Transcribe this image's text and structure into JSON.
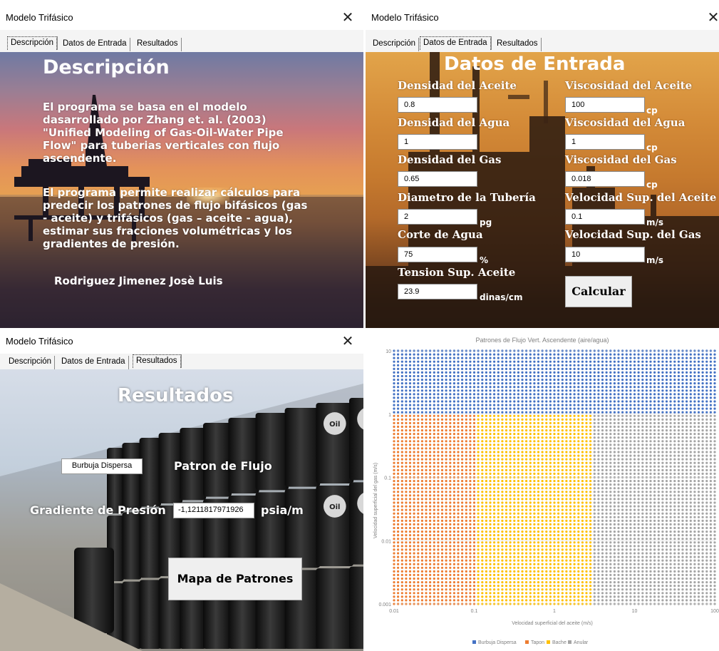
{
  "window1": {
    "title": "Modelo Trifásico",
    "close": "✕",
    "tabs": [
      "Descripción",
      "Datos de Entrada",
      "Resultados"
    ],
    "heading": "Descripción",
    "paragraph1": "El programa se basa en el modelo dasarrollado por Zhang et. al. (2003) \"Unified Modeling of Gas-Oil-Water Pipe Flow\" para tuberias verticales con flujo ascendente.",
    "paragraph2": "El programa permite realizar cálculos para predecir los patrones de flujo bifásicos (gas - aceite) y trifásicos (gas – aceite - agua), estimar sus fracciones volumétricas y los gradientes de presión.",
    "author": "Rodriguez Jimenez Josè Luis"
  },
  "window2": {
    "title": "Modelo Trifásico",
    "close": "✕",
    "tabs": [
      "Descripción",
      "Datos de Entrada",
      "Resultados"
    ],
    "heading": "Datos de Entrada",
    "fields": {
      "densidad_aceite": {
        "label": "Densidad del Aceite",
        "value": "0.8",
        "unit": ""
      },
      "densidad_agua": {
        "label": "Densidad del Agua",
        "value": "1",
        "unit": ""
      },
      "densidad_gas": {
        "label": "Densidad del Gas",
        "value": "0.65",
        "unit": ""
      },
      "diametro": {
        "label": "Diametro de la Tubería",
        "value": "2",
        "unit": "pg"
      },
      "corte_agua": {
        "label": "Corte de Agua",
        "value": "75",
        "unit": "%"
      },
      "tension": {
        "label": "Tension Sup. Aceite",
        "value": "23.9",
        "unit": "dinas/cm"
      },
      "visc_aceite": {
        "label": "Viscosidad del Aceite",
        "value": "100",
        "unit": "cp"
      },
      "visc_agua": {
        "label": "Viscosidad del Agua",
        "value": "1",
        "unit": "cp"
      },
      "visc_gas": {
        "label": "Viscosidad del Gas",
        "value": "0.018",
        "unit": "cp"
      },
      "vel_aceite": {
        "label": "Velocidad Sup. del Aceite",
        "value": "0.1",
        "unit": "m/s"
      },
      "vel_gas": {
        "label": "Velocidad Sup. del Gas",
        "value": "10",
        "unit": "m/s"
      }
    },
    "calc_button": "Calcular"
  },
  "window3": {
    "title": "Modelo Trifásico",
    "close": "✕",
    "tabs": [
      "Descripción",
      "Datos de Entrada",
      "Resultados"
    ],
    "heading": "Resultados",
    "pattern_value": "Burbuja Dispersa",
    "pattern_label": "Patron de Flujo",
    "gradient_label": "Gradiente de Presión",
    "gradient_value": "-1,1211817971926",
    "gradient_unit": "psia/m",
    "map_button": "Mapa de Patrones",
    "barrel_text": "Oil"
  },
  "chart_data": {
    "type": "scatter",
    "title": "Patrones de Flujo Vert. Ascendente (aire/agua)",
    "xlabel": "Velocidad superficial del aceite (m/s)",
    "ylabel": "Velocidad superficial del gas (m/s)",
    "x_scale": "log",
    "y_scale": "log",
    "xlim": [
      0.01,
      100
    ],
    "ylim": [
      0.001,
      10
    ],
    "x_ticks": [
      "0.01",
      "0.1",
      "1",
      "10",
      "100"
    ],
    "y_ticks": [
      "0.001",
      "0.01",
      "0.1",
      "1",
      "10"
    ],
    "legend_placement": "bottom",
    "series": [
      {
        "name": "Burbuja Dispersa",
        "color": "#4472c4"
      },
      {
        "name": "Tapon",
        "color": "#ed7d31"
      },
      {
        "name": "Bache",
        "color": "#ffc000"
      },
      {
        "name": "Anular",
        "color": "#a5a5a5"
      }
    ],
    "regions": [
      {
        "series": "Burbuja Dispersa",
        "y_from": 1,
        "y_to": 10,
        "x_from": 0.01,
        "x_to": 100
      },
      {
        "series": "Tapon",
        "y_from": 0.001,
        "y_to": 1,
        "x_from": 0.01,
        "x_to": 0.1
      },
      {
        "series": "Bache",
        "y_from": 0.001,
        "y_to": 1,
        "x_from": 0.1,
        "x_to": 3
      },
      {
        "series": "Anular",
        "y_from": 0.001,
        "y_to": 1,
        "x_from": 3,
        "x_to": 100
      }
    ]
  },
  "colors": {
    "blue": "#4472c4",
    "orange": "#ed7d31",
    "yellow": "#ffc000",
    "gray": "#a5a5a5"
  }
}
